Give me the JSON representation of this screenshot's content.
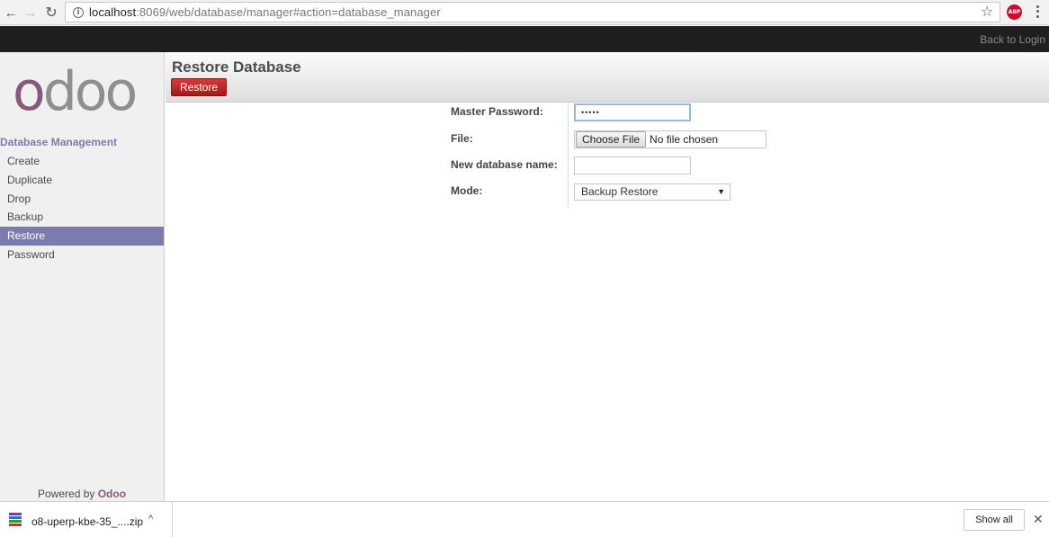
{
  "browser": {
    "url_host": "localhost",
    "url_path": ":8069/web/database/manager#action=database_manager",
    "abp_label": "ABP"
  },
  "topbar": {
    "back_link": "Back to Login"
  },
  "sidebar": {
    "logo_first": "o",
    "logo_rest": "doo",
    "section_title": "Database Management",
    "items": [
      {
        "label": "Create",
        "active": false
      },
      {
        "label": "Duplicate",
        "active": false
      },
      {
        "label": "Drop",
        "active": false
      },
      {
        "label": "Backup",
        "active": false
      },
      {
        "label": "Restore",
        "active": true
      },
      {
        "label": "Password",
        "active": false
      }
    ],
    "powered_prefix": "Powered by",
    "powered_brand": "Odoo"
  },
  "header": {
    "title": "Restore Database",
    "restore_label": "Restore"
  },
  "form": {
    "master_password_label": "Master Password:",
    "master_password_value": "•••••",
    "file_label": "File:",
    "choose_file_label": "Choose File",
    "file_status": "No file chosen",
    "new_db_label": "New database name:",
    "new_db_value": "",
    "mode_label": "Mode:",
    "mode_value": "Backup Restore"
  },
  "downloads": {
    "file_name": "o8-uperp-kbe-35_....zip",
    "show_all_label": "Show all"
  },
  "colors": {
    "accent": "#7c7bad",
    "brand": "#875a7b",
    "danger": "#c12a2a"
  }
}
